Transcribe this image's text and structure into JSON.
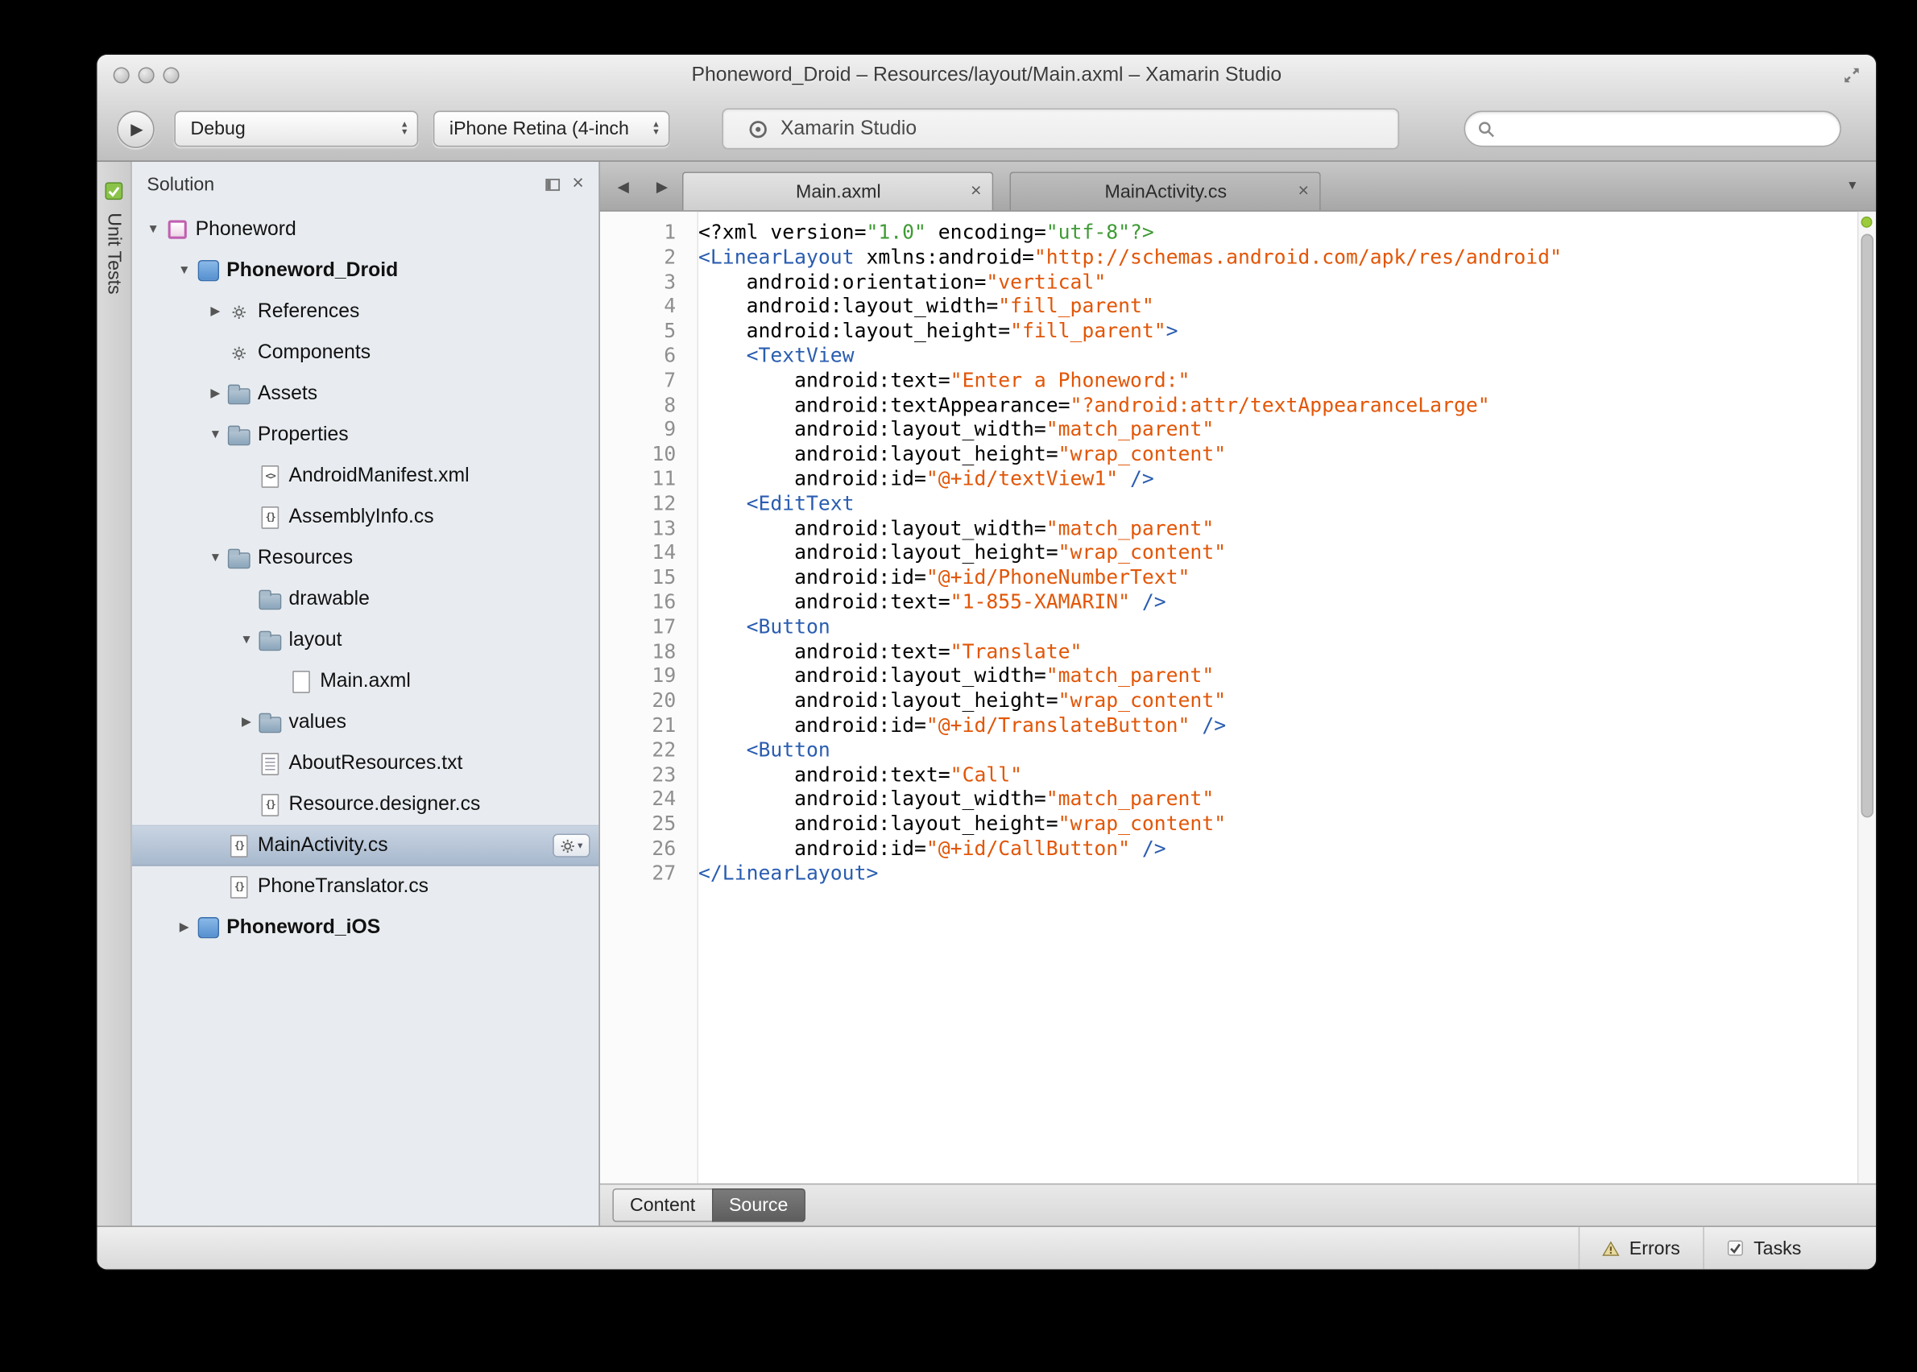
{
  "window": {
    "title": "Phoneword_Droid – Resources/layout/Main.axml – Xamarin Studio"
  },
  "toolbar": {
    "configuration": "Debug",
    "device": "iPhone Retina (4-inch",
    "status_text": "Xamarin Studio",
    "search_value": ""
  },
  "unit_tests_tab": {
    "label": "Unit Tests"
  },
  "sidebar": {
    "title": "Solution",
    "tree": [
      {
        "label": "Phoneword",
        "level": 0,
        "expander": "open",
        "icon": "solution",
        "bold": false
      },
      {
        "label": "Phoneword_Droid",
        "level": 1,
        "expander": "open",
        "icon": "project",
        "bold": true
      },
      {
        "label": "References",
        "level": 2,
        "expander": "closed",
        "icon": "references",
        "bold": false
      },
      {
        "label": "Components",
        "level": 2,
        "expander": "none",
        "icon": "components",
        "bold": false
      },
      {
        "label": "Assets",
        "level": 2,
        "expander": "closed",
        "icon": "folder",
        "bold": false
      },
      {
        "label": "Properties",
        "level": 2,
        "expander": "open",
        "icon": "folder",
        "bold": false
      },
      {
        "label": "AndroidManifest.xml",
        "level": 3,
        "expander": "none",
        "icon": "xml-file",
        "bold": false
      },
      {
        "label": "AssemblyInfo.cs",
        "level": 3,
        "expander": "none",
        "icon": "cs-file",
        "bold": false
      },
      {
        "label": "Resources",
        "level": 2,
        "expander": "open",
        "icon": "folder",
        "bold": false
      },
      {
        "label": "drawable",
        "level": 3,
        "expander": "none",
        "icon": "folder",
        "bold": false
      },
      {
        "label": "layout",
        "level": 3,
        "expander": "open",
        "icon": "folder",
        "bold": false
      },
      {
        "label": "Main.axml",
        "level": 4,
        "expander": "none",
        "icon": "file",
        "bold": false
      },
      {
        "label": "values",
        "level": 3,
        "expander": "closed",
        "icon": "folder",
        "bold": false
      },
      {
        "label": "AboutResources.txt",
        "level": 3,
        "expander": "none",
        "icon": "txt-file",
        "bold": false
      },
      {
        "label": "Resource.designer.cs",
        "level": 3,
        "expander": "none",
        "icon": "cs-file",
        "bold": false
      },
      {
        "label": "MainActivity.cs",
        "level": 2,
        "expander": "none",
        "icon": "cs-file",
        "bold": false,
        "selected": true,
        "gear": true
      },
      {
        "label": "PhoneTranslator.cs",
        "level": 2,
        "expander": "none",
        "icon": "cs-file",
        "bold": false
      },
      {
        "label": "Phoneword_iOS",
        "level": 1,
        "expander": "closed",
        "icon": "project",
        "bold": true
      }
    ]
  },
  "editor": {
    "tabs": [
      {
        "label": "Main.axml",
        "active": true
      },
      {
        "label": "MainActivity.cs",
        "active": false
      }
    ],
    "bottom_tabs": [
      {
        "label": "Content",
        "active": false
      },
      {
        "label": "Source",
        "active": true
      }
    ],
    "code_lines": [
      [
        [
          "p",
          "<?xml version="
        ],
        [
          "g",
          "\"1.0\""
        ],
        [
          "p",
          " encoding="
        ],
        [
          "g",
          "\"utf-8\""
        ],
        [
          "g",
          "?>"
        ]
      ],
      [
        [
          "t",
          "<LinearLayout"
        ],
        [
          "p",
          " xmlns:android="
        ],
        [
          "s",
          "\"http://schemas.android.com/apk/res/android\""
        ]
      ],
      [
        [
          "p",
          "    android:orientation="
        ],
        [
          "s",
          "\"vertical\""
        ]
      ],
      [
        [
          "p",
          "    android:layout_width="
        ],
        [
          "s",
          "\"fill_parent\""
        ]
      ],
      [
        [
          "p",
          "    android:layout_height="
        ],
        [
          "s",
          "\"fill_parent\""
        ],
        [
          "t",
          ">"
        ]
      ],
      [
        [
          "p",
          "    "
        ],
        [
          "t",
          "<TextView"
        ]
      ],
      [
        [
          "p",
          "        android:text="
        ],
        [
          "s",
          "\"Enter a Phoneword:\""
        ]
      ],
      [
        [
          "p",
          "        android:textAppearance="
        ],
        [
          "s",
          "\"?android:attr/textAppearanceLarge\""
        ]
      ],
      [
        [
          "p",
          "        android:layout_width="
        ],
        [
          "s",
          "\"match_parent\""
        ]
      ],
      [
        [
          "p",
          "        android:layout_height="
        ],
        [
          "s",
          "\"wrap_content\""
        ]
      ],
      [
        [
          "p",
          "        android:id="
        ],
        [
          "s",
          "\"@+id/textView1\""
        ],
        [
          "t",
          " />"
        ]
      ],
      [
        [
          "p",
          "    "
        ],
        [
          "t",
          "<EditText"
        ]
      ],
      [
        [
          "p",
          "        android:layout_width="
        ],
        [
          "s",
          "\"match_parent\""
        ]
      ],
      [
        [
          "p",
          "        android:layout_height="
        ],
        [
          "s",
          "\"wrap_content\""
        ]
      ],
      [
        [
          "p",
          "        android:id="
        ],
        [
          "s",
          "\"@+id/PhoneNumberText\""
        ]
      ],
      [
        [
          "p",
          "        android:text="
        ],
        [
          "s",
          "\"1-855-XAMARIN\""
        ],
        [
          "t",
          " />"
        ]
      ],
      [
        [
          "p",
          "    "
        ],
        [
          "t",
          "<Button"
        ]
      ],
      [
        [
          "p",
          "        android:text="
        ],
        [
          "s",
          "\"Translate\""
        ]
      ],
      [
        [
          "p",
          "        android:layout_width="
        ],
        [
          "s",
          "\"match_parent\""
        ]
      ],
      [
        [
          "p",
          "        android:layout_height="
        ],
        [
          "s",
          "\"wrap_content\""
        ]
      ],
      [
        [
          "p",
          "        android:id="
        ],
        [
          "s",
          "\"@+id/TranslateButton\""
        ],
        [
          "t",
          " />"
        ]
      ],
      [
        [
          "p",
          "    "
        ],
        [
          "t",
          "<Button"
        ]
      ],
      [
        [
          "p",
          "        android:text="
        ],
        [
          "s",
          "\"Call\""
        ]
      ],
      [
        [
          "p",
          "        android:layout_width="
        ],
        [
          "s",
          "\"match_parent\""
        ]
      ],
      [
        [
          "p",
          "        android:layout_height="
        ],
        [
          "s",
          "\"wrap_content\""
        ]
      ],
      [
        [
          "p",
          "        android:id="
        ],
        [
          "s",
          "\"@+id/CallButton\""
        ],
        [
          "t",
          " />"
        ]
      ],
      [
        [
          "t",
          "</LinearLayout>"
        ]
      ]
    ]
  },
  "statusbar": {
    "errors": "Errors",
    "tasks": "Tasks"
  },
  "colors": {
    "tag": "#2a5db0",
    "string": "#e25607",
    "declaration": "#3f9b35",
    "selection": "#aebccd",
    "ok_dot": "#9ccc3c"
  }
}
